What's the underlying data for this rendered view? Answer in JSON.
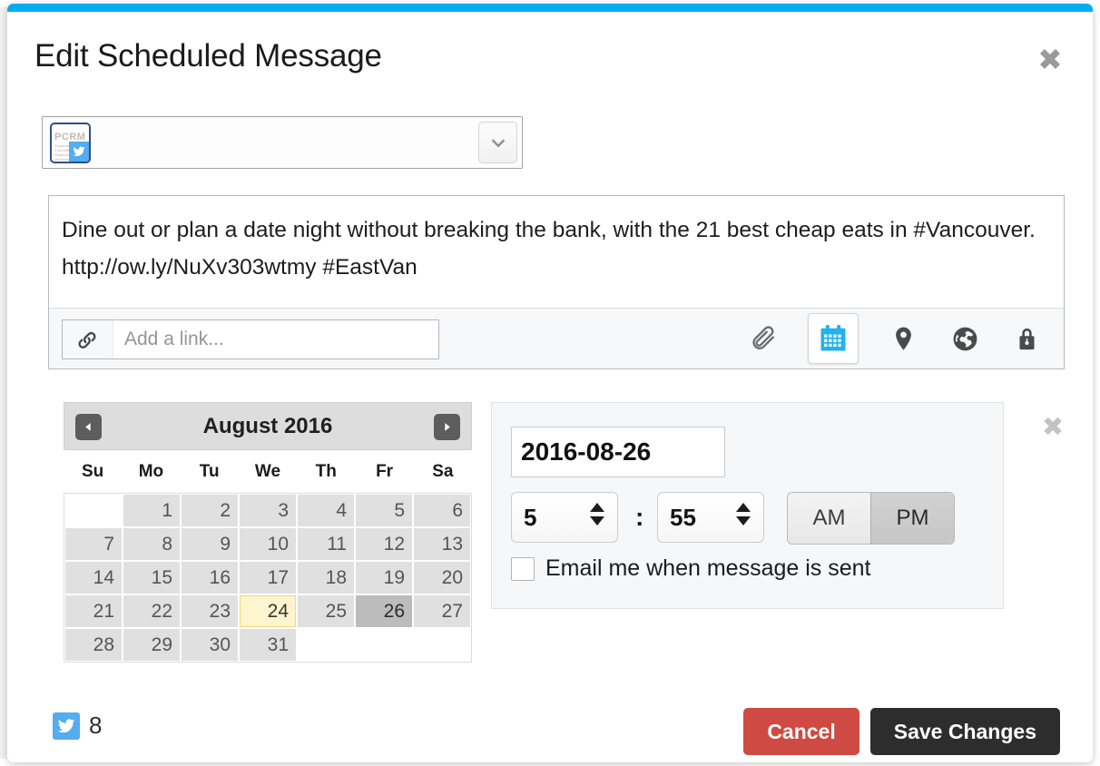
{
  "dialog": {
    "title": "Edit Scheduled Message",
    "close_label": "✖",
    "accent_color": "#00adef"
  },
  "profile": {
    "avatar_text": "PCRM",
    "avatar_subtext": "Physicians Committee for Responsible Medicine",
    "network_icon": "twitter-icon",
    "caret_icon": "chevron-down-icon"
  },
  "compose": {
    "message": "Dine out or plan a date night without breaking the bank, with the 21 best cheap eats in #Vancouver. http://ow.ly/NuXv303wtmy #EastVan",
    "link_placeholder": "Add a link...",
    "link_value": "",
    "link_icon": "link-icon",
    "tools": [
      {
        "name": "attachment-icon",
        "label": "Attach file",
        "active": false
      },
      {
        "name": "calendar-icon",
        "label": "Schedule",
        "active": true
      },
      {
        "name": "location-pin-icon",
        "label": "Location",
        "active": false
      },
      {
        "name": "globe-icon",
        "label": "Language",
        "active": false
      },
      {
        "name": "lock-icon",
        "label": "Privacy",
        "active": false
      }
    ]
  },
  "calendar": {
    "month_label": "August 2016",
    "prev_icon": "caret-left-icon",
    "next_icon": "caret-right-icon",
    "day_headers": [
      "Su",
      "Mo",
      "Tu",
      "We",
      "Th",
      "Fr",
      "Sa"
    ],
    "leading_blanks": 1,
    "days": [
      1,
      2,
      3,
      4,
      5,
      6,
      7,
      8,
      9,
      10,
      11,
      12,
      13,
      14,
      15,
      16,
      17,
      18,
      19,
      20,
      21,
      22,
      23,
      24,
      25,
      26,
      27,
      28,
      29,
      30,
      31
    ],
    "today": 24,
    "selected": 26,
    "today_color": "#fdf5ce",
    "selected_color": "#bcbcbc"
  },
  "schedule": {
    "close_label": "✖",
    "date_value": "2016-08-26",
    "hour_value": "5",
    "minute_value": "55",
    "time_separator": ":",
    "meridiem_options": [
      "AM",
      "PM"
    ],
    "meridiem_selected": "PM",
    "email_label": "Email me when message is sent",
    "email_checked": false
  },
  "footer": {
    "network_icon": "twitter-icon",
    "character_count": "8",
    "cancel_label": "Cancel",
    "save_label": "Save Changes",
    "cancel_color": "#cf4a42",
    "save_color": "#2d2d2d"
  }
}
